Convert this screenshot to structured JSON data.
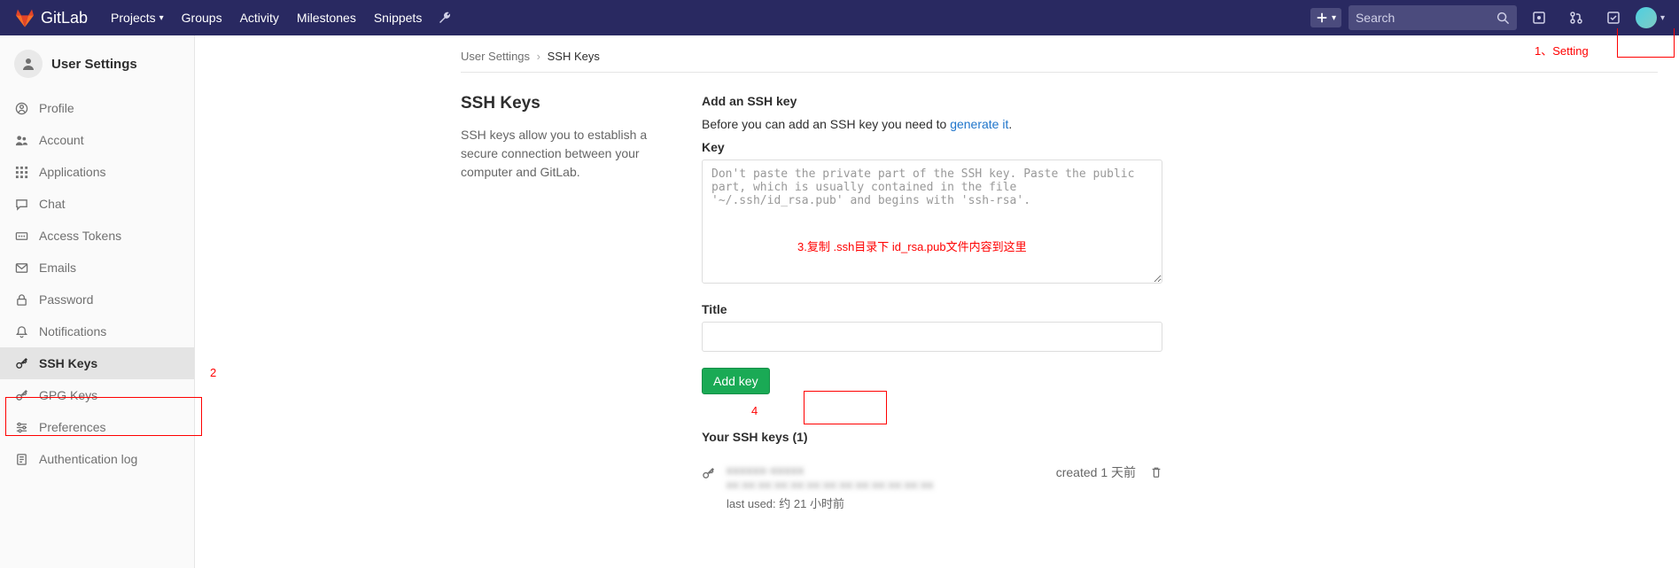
{
  "brand": "GitLab",
  "nav": {
    "projects": "Projects",
    "groups": "Groups",
    "activity": "Activity",
    "milestones": "Milestones",
    "snippets": "Snippets"
  },
  "search_placeholder": "Search",
  "sidebar": {
    "title": "User Settings",
    "items": [
      {
        "label": "Profile"
      },
      {
        "label": "Account"
      },
      {
        "label": "Applications"
      },
      {
        "label": "Chat"
      },
      {
        "label": "Access Tokens"
      },
      {
        "label": "Emails"
      },
      {
        "label": "Password"
      },
      {
        "label": "Notifications"
      },
      {
        "label": "SSH Keys"
      },
      {
        "label": "GPG Keys"
      },
      {
        "label": "Preferences"
      },
      {
        "label": "Authentication log"
      }
    ]
  },
  "crumb": {
    "root": "User Settings",
    "current": "SSH Keys"
  },
  "section": {
    "title": "SSH Keys",
    "desc": "SSH keys allow you to establish a secure connection between your computer and GitLab."
  },
  "form": {
    "heading": "Add an SSH key",
    "hint_before": "Before you can add an SSH key you need to ",
    "hint_link": "generate it",
    "hint_after": ".",
    "key_label": "Key",
    "key_placeholder": "Don't paste the private part of the SSH key. Paste the public part, which is usually contained in the file '~/.ssh/id_rsa.pub' and begins with 'ssh-rsa'.",
    "title_label": "Title",
    "button": "Add key"
  },
  "keys_list": {
    "heading": "Your SSH keys (1)",
    "items": [
      {
        "created": "created 1 天前",
        "last_used": "last used: 约 21 小时前"
      }
    ]
  },
  "annotations": {
    "a1": "1、Setting",
    "a2": "2",
    "a3": "3.复制 .ssh目录下 id_rsa.pub文件内容到这里",
    "a4": "4"
  }
}
